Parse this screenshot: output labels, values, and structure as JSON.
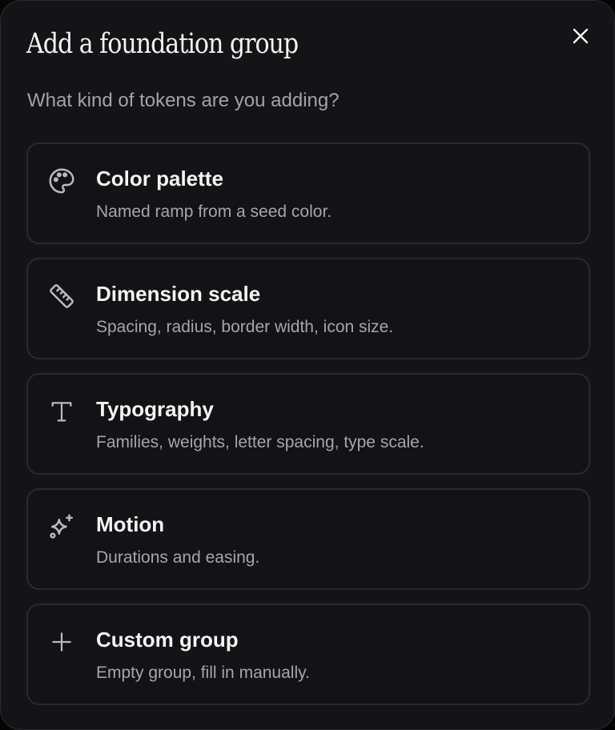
{
  "dialog": {
    "title": "Add a foundation group",
    "subtitle": "What kind of tokens are you adding?",
    "close_icon": "close-icon"
  },
  "options": [
    {
      "label": "Color palette",
      "description": "Named ramp from a seed color.",
      "icon": "palette-icon"
    },
    {
      "label": "Dimension scale",
      "description": "Spacing, radius, border width, icon size.",
      "icon": "ruler-icon"
    },
    {
      "label": "Typography",
      "description": "Families, weights, letter spacing, type scale.",
      "icon": "text-type-icon"
    },
    {
      "label": "Motion",
      "description": "Durations and easing.",
      "icon": "sparkles-icon"
    },
    {
      "label": "Custom group",
      "description": "Empty group, fill in manually.",
      "icon": "plus-icon"
    }
  ],
  "colors": {
    "modal_background": "#141416",
    "card_border": "#2a2a2e",
    "title_text": "#f2f2f3",
    "muted_text": "#a2a2a8"
  }
}
